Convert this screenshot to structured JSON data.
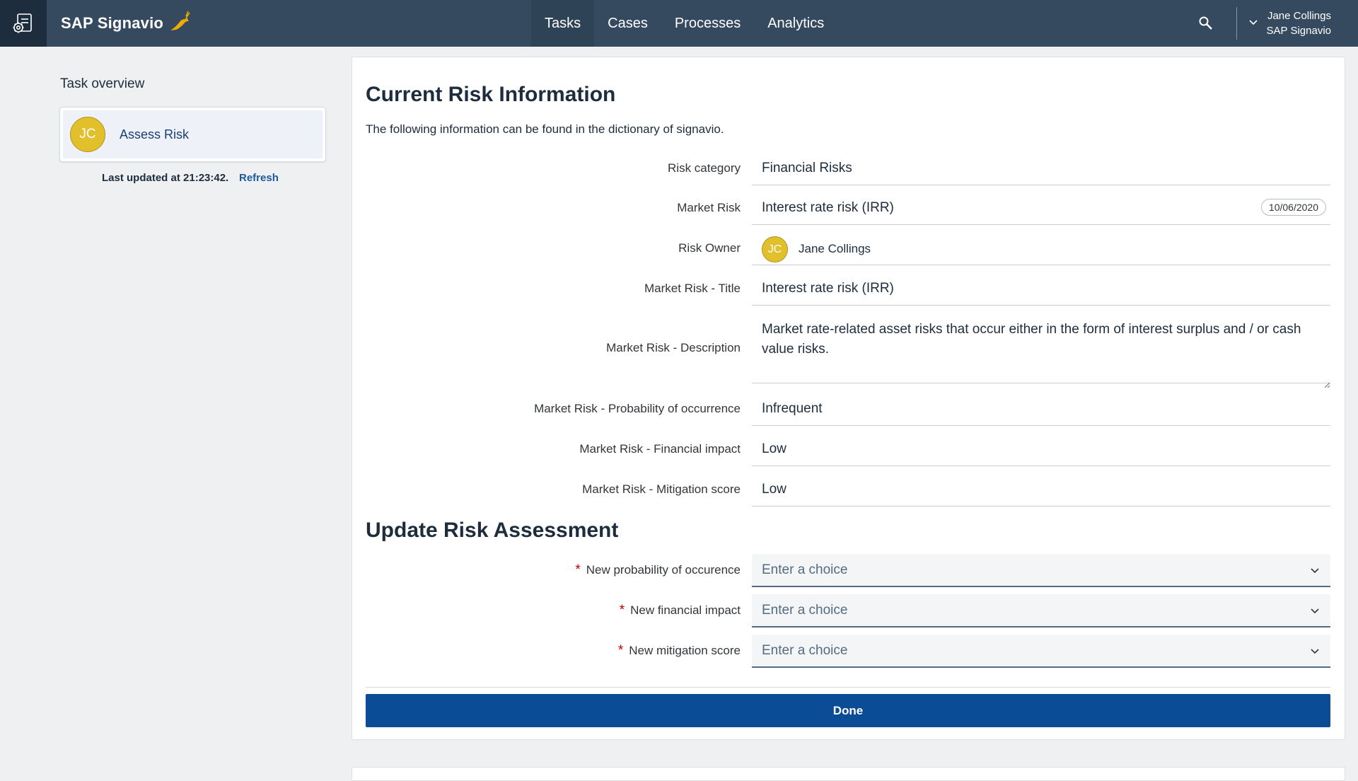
{
  "header": {
    "app_icon": "settings-tasks-icon",
    "brand": "SAP Signavio",
    "brand_icon": "gazelle-icon",
    "nav": [
      {
        "label": "Tasks",
        "active": true
      },
      {
        "label": "Cases",
        "active": false
      },
      {
        "label": "Processes",
        "active": false
      },
      {
        "label": "Analytics",
        "active": false
      }
    ],
    "search_icon": "search-icon",
    "user": {
      "name": "Jane Collings",
      "org": "SAP Signavio"
    }
  },
  "sidebar": {
    "title": "Task overview",
    "tasks": [
      {
        "initials": "JC",
        "label": "Assess Risk"
      }
    ],
    "last_updated": "Last updated at 21:23:42.",
    "refresh": "Refresh"
  },
  "current": {
    "title": "Current Risk Information",
    "intro": "The following information can be found in the dictionary of signavio.",
    "fields": {
      "risk_category": {
        "label": "Risk category",
        "value": "Financial Risks"
      },
      "market_risk": {
        "label": "Market Risk",
        "value": "Interest rate risk (IRR)",
        "date": "10/06/2020"
      },
      "risk_owner": {
        "label": "Risk Owner",
        "initials": "JC",
        "value": "Jane Collings"
      },
      "title": {
        "label": "Market Risk - Title",
        "value": "Interest rate risk (IRR)"
      },
      "description": {
        "label": "Market Risk - Description",
        "value": "Market rate-related asset risks that occur either in the form of interest surplus and / or cash value risks."
      },
      "probability": {
        "label": "Market Risk - Probability of occurrence",
        "value": "Infrequent"
      },
      "financial": {
        "label": "Market Risk - Financial impact",
        "value": "Low"
      },
      "mitigation": {
        "label": "Market Risk - Mitigation score",
        "value": "Low"
      }
    }
  },
  "update": {
    "title": "Update Risk Assessment",
    "required_mark": "*",
    "fields": {
      "probability": {
        "label": "New probability of occurence",
        "placeholder": "Enter a choice"
      },
      "financial": {
        "label": "New financial impact",
        "placeholder": "Enter a choice"
      },
      "mitigation": {
        "label": "New mitigation score",
        "placeholder": "Enter a choice"
      }
    },
    "done": "Done"
  },
  "colors": {
    "topbar": "#354a5f",
    "accent": "#0a4c96",
    "avatar": "#e2c02c",
    "required": "#bb0000"
  }
}
